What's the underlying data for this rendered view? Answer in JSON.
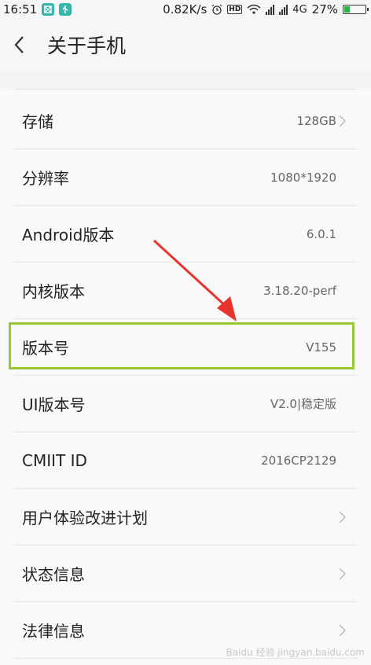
{
  "status_bar": {
    "time": "16:51",
    "speed": "0.82K/s",
    "hd": "HD",
    "network": "4G",
    "battery": "27%",
    "battery_level": 0.27
  },
  "header": {
    "title": "关于手机"
  },
  "rows": [
    {
      "label": "存储",
      "value": "128GB",
      "chevron": true
    },
    {
      "label": "分辨率",
      "value": "1080*1920",
      "chevron": false
    },
    {
      "label": "Android版本",
      "value": "6.0.1",
      "chevron": false
    },
    {
      "label": "内核版本",
      "value": "3.18.20-perf",
      "chevron": false
    },
    {
      "label": "版本号",
      "value": "V155",
      "chevron": false
    },
    {
      "label": "UI版本号",
      "value": "V2.0|稳定版",
      "chevron": false
    },
    {
      "label": "CMIIT ID",
      "value": "2016CP2129",
      "chevron": false
    },
    {
      "label": "用户体验改进计划",
      "value": "",
      "chevron": true
    },
    {
      "label": "状态信息",
      "value": "",
      "chevron": true
    },
    {
      "label": "法律信息",
      "value": "",
      "chevron": true
    }
  ],
  "watermark": "Baidu 经验 jingyan.baidu.com",
  "colors": {
    "highlight": "#96c83a",
    "arrow": "#e8342c",
    "accent": "#37b6a9",
    "battery": "#2bb14a"
  }
}
